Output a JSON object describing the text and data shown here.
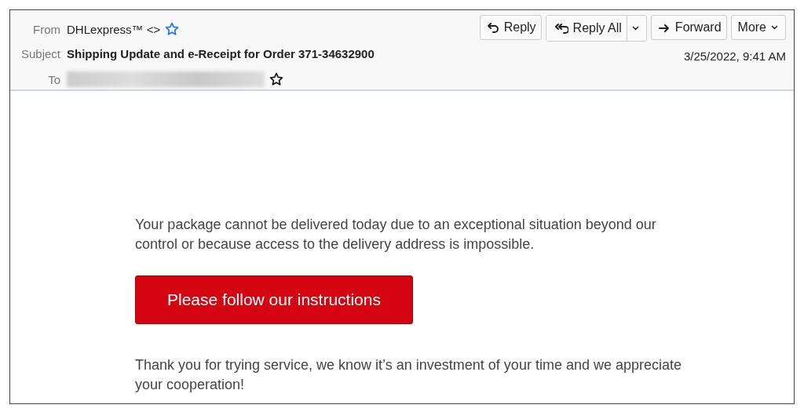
{
  "header": {
    "from_label": "From",
    "from": "DHLexpress™ <>",
    "subject_label": "Subject",
    "subject": "Shipping Update and e-Receipt for Order 371-34632900",
    "to_label": "To",
    "date": "3/25/2022, 9:41 AM"
  },
  "buttons": [
    {
      "label": "Reply",
      "kind": "reply"
    },
    {
      "label": "Reply All",
      "kind": "reply_all"
    },
    {
      "label": "Forward",
      "kind": "forward"
    },
    {
      "label": "More",
      "kind": "more"
    }
  ],
  "body": {
    "intro": "Your package cannot be delivered today due to an exceptional situation beyond our control or because access to the delivery address is impossible.",
    "cta": "Please follow our instructions",
    "closing": "Thank you for trying service, we know it’s an investment of your time and we appreciate your cooperation!"
  }
}
